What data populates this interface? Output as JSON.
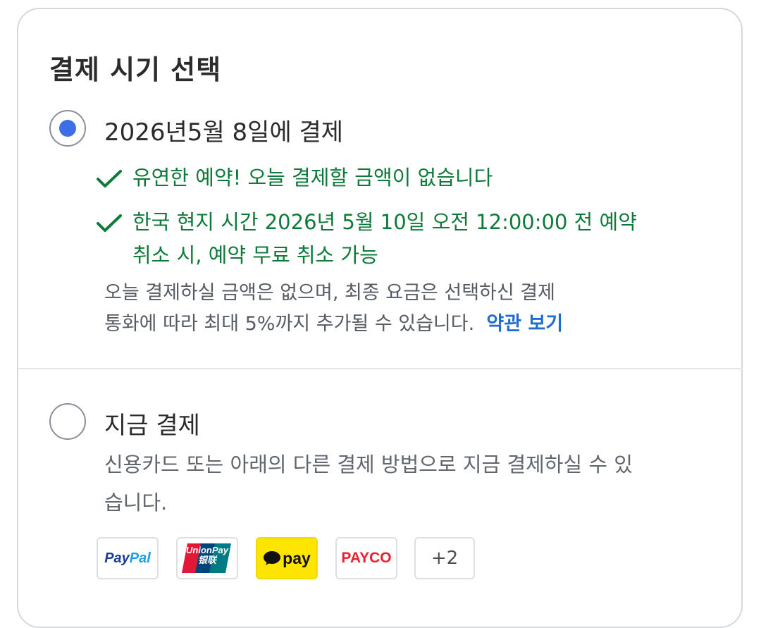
{
  "section": {
    "title": "결제 시기 선택"
  },
  "option_later": {
    "label": "2026년5월 8일에 결제",
    "selected": true,
    "benefits": [
      {
        "text": "유연한 예약! 오늘 결제할 금액이 없습니다"
      },
      {
        "line1": "한국 현지 시간 2026년 5월 10일 오전 12:00:00 전 예약",
        "line2": "취소 시, 예약 무료 취소 가능"
      }
    ],
    "note_line1": "오늘 결제하실 금액은 없으며, 최종 요금은 선택하신 결제",
    "note_line2": "통화에 따라 최대 5%까지 추가될 수 있습니다.",
    "terms_link": "약관 보기"
  },
  "option_now": {
    "label": "지금 결제",
    "selected": false,
    "desc_line1": "신용카드 또는 아래의 다른 결제 방법으로 지금 결제하실 수 있",
    "desc_line2": "습니다."
  },
  "payment_methods": {
    "paypal": {
      "pay": "Pay",
      "pal": "Pal"
    },
    "unionpay": {
      "en": "UnionPay",
      "zh": "银联"
    },
    "kakaopay": {
      "text": "pay"
    },
    "payco": {
      "text": "PAYCO"
    },
    "more": "+2"
  },
  "colors": {
    "accent_blue": "#3d6ee6",
    "success_green": "#0e7a3a",
    "link_blue": "#1f6ccf",
    "kakao_yellow": "#fee500",
    "payco_red": "#e8212f"
  }
}
